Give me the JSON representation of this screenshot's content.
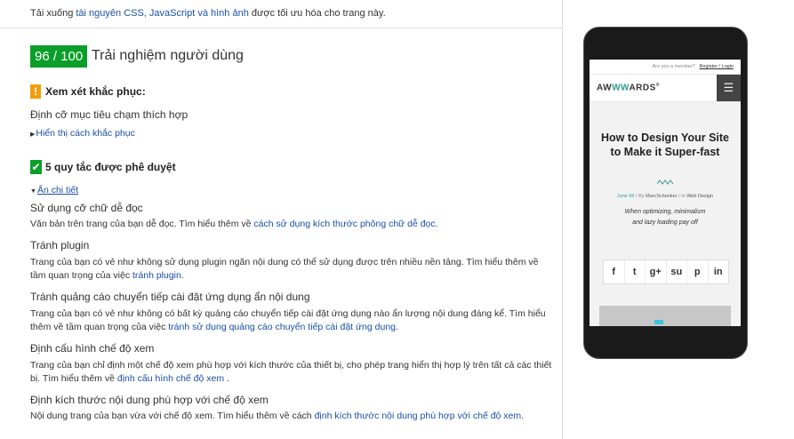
{
  "top_note": {
    "prefix": "Tải xuống ",
    "link": "tài nguyên CSS, JavaScript và hình ảnh",
    "suffix": " được tối ưu hóa cho trang này."
  },
  "score": {
    "value": "96 / 100",
    "title": "Trải nghiệm người dùng",
    "color": "#0b9e2a"
  },
  "consider_fixing": {
    "icon": "!",
    "title": "Xem xét khắc phục:",
    "rule_title": "Định cỡ mục tiêu chạm thích hợp",
    "toggle": "Hiển thị cách khắc phục",
    "color": "#f29e0c"
  },
  "passed": {
    "icon": "✔",
    "title": "5 quy tắc được phê duyệt",
    "toggle": "Ẩn chi tiết",
    "rules": [
      {
        "title": "Sử dụng cỡ chữ dễ đọc",
        "desc": "Văn bản trên trang của bạn dễ đọc. Tìm hiểu thêm về ",
        "link": "cách sử dụng kích thước phông chữ dễ đọc",
        "after": "."
      },
      {
        "title": "Tránh plugin",
        "desc": "Trang của bạn có vẻ như không sử dụng plugin ngăn nội dung có thể sử dụng được trên nhiều nền tảng. Tìm hiểu thêm về tầm quan trọng của việc ",
        "link": "tránh plugin",
        "after": "."
      },
      {
        "title": "Tránh quảng cáo chuyển tiếp cài đặt ứng dụng ẩn nội dung",
        "desc": "Trang của bạn có vẻ như không có bất kỳ quảng cáo chuyển tiếp cài đặt ứng dụng nào ẩn lượng nội dung đáng kể. Tìm hiểu thêm về tầm quan trọng của việc ",
        "link": "tránh sử dụng quảng cáo chuyển tiếp cài đặt ứng dụng",
        "after": "."
      },
      {
        "title": "Định cấu hình chế độ xem",
        "desc": "Trang của bạn chỉ định một chế độ xem phù hợp với kích thước của thiết bị, cho phép trang hiển thị hợp lý trên tất cả các thiết bị. Tìm hiểu thêm về ",
        "link": "định cấu hình chế độ xem",
        "after": " ."
      },
      {
        "title": "Định kích thước nội dung phù hợp với chế độ xem",
        "desc": "Nội dung trang của bạn vừa với chế độ xem. Tìm hiểu thêm về cách ",
        "link": "định kích thước nội dung phù hợp với chế độ xem",
        "after": "."
      }
    ]
  },
  "phone": {
    "topbar_question": "Are you a member?",
    "topbar_link": "Register / Login",
    "logo_pre": "AW",
    "logo_ww": "WW",
    "logo_post": "ARDS",
    "logo_mark": "®",
    "menu_icon": "☰",
    "title": "How to Design Your Site to Make it Super-fast",
    "meta_date": "June 06",
    "meta_by": " / By ",
    "meta_author": "MarcSchenker",
    "meta_in": " / In ",
    "meta_category": "Web Design",
    "excerpt": "When optimizing, minimalism and lazy loading pay off",
    "social": [
      "f",
      "t",
      "g+",
      "su",
      "p",
      "in"
    ],
    "accent": "#2e9c94"
  }
}
